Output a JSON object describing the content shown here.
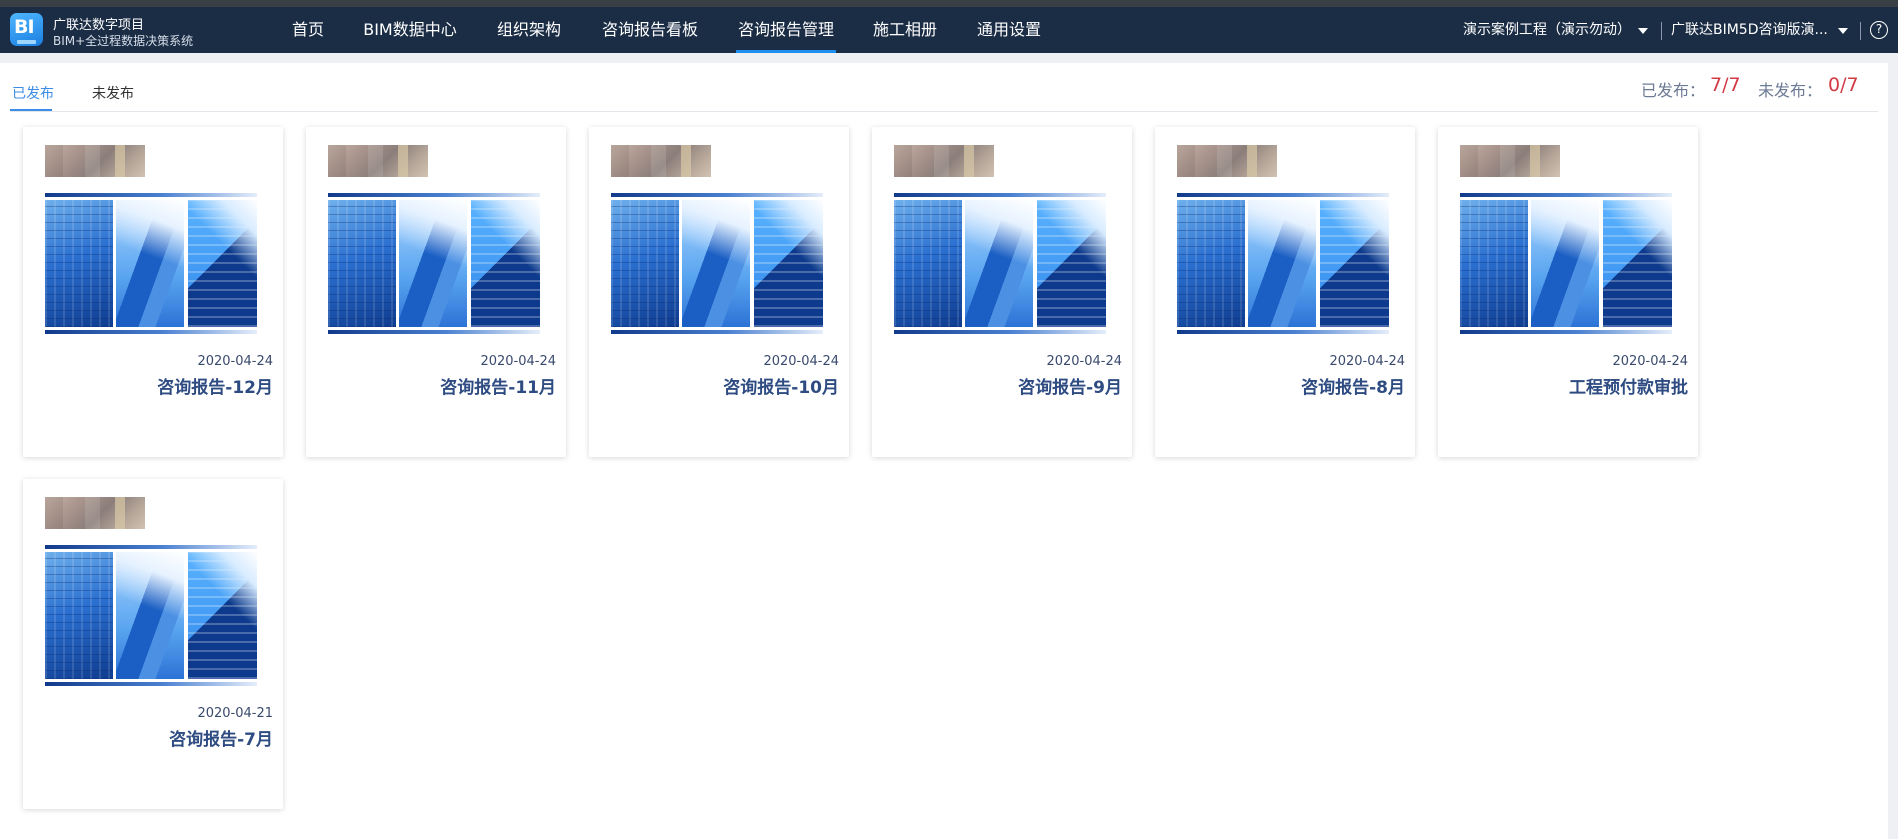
{
  "app": {
    "title": "广联达数字项目",
    "subtitle": "BIM+全过程数据决策系统",
    "logo_text": "BI"
  },
  "nav": {
    "items": [
      {
        "label": "首页",
        "active": false
      },
      {
        "label": "BIM数据中心",
        "active": false
      },
      {
        "label": "组织架构",
        "active": false
      },
      {
        "label": "咨询报告看板",
        "active": false
      },
      {
        "label": "咨询报告管理",
        "active": true
      },
      {
        "label": "施工相册",
        "active": false
      },
      {
        "label": "通用设置",
        "active": false
      }
    ],
    "project_selector": "演示案例工程（演示勿动）",
    "version_selector": "广联达BIM5D咨询版演...",
    "help_icon": "?"
  },
  "tabs": [
    {
      "label": "已发布",
      "active": true
    },
    {
      "label": "未发布",
      "active": false
    }
  ],
  "stats": {
    "published_label": "已发布：",
    "published_value": "7/7",
    "unpublished_label": "未发布：",
    "unpublished_value": "0/7"
  },
  "reports": [
    {
      "date": "2020-04-24",
      "title": "咨询报告-12月"
    },
    {
      "date": "2020-04-24",
      "title": "咨询报告-11月"
    },
    {
      "date": "2020-04-24",
      "title": "咨询报告-10月"
    },
    {
      "date": "2020-04-24",
      "title": "咨询报告-9月"
    },
    {
      "date": "2020-04-24",
      "title": "咨询报告-8月"
    },
    {
      "date": "2020-04-24",
      "title": "工程预付款审批"
    },
    {
      "date": "2020-04-21",
      "title": "咨询报告-7月"
    }
  ],
  "colors": {
    "navbar_bg": "#1b2d45",
    "accent": "#1e8ef0",
    "stat_value": "#d23a46",
    "card_title": "#2e4c82"
  }
}
